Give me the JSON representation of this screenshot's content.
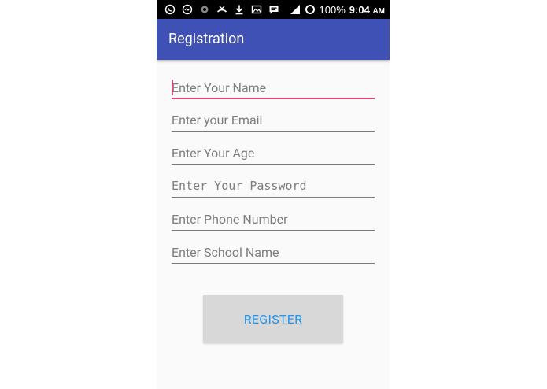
{
  "status_bar": {
    "left_icons": [
      "whatsapp-icon",
      "messenger-icon",
      "record-icon",
      "missed-call-icon",
      "download-icon",
      "gallery-icon",
      "sms-icon"
    ],
    "right_icons": [
      "signal-icon",
      "circle-icon"
    ],
    "battery": "100%",
    "time": "9:04",
    "ampm": "AM"
  },
  "app_bar": {
    "title": "Registration",
    "color": "#3f51b5"
  },
  "form": {
    "name_placeholder": "Enter Your Name",
    "email_placeholder": "Enter your Email",
    "age_placeholder": "Enter Your Age",
    "password_placeholder": "Enter Your Password",
    "phone_placeholder": "Enter Phone Number",
    "school_placeholder": "Enter School Name",
    "accent_color": "#e0457b"
  },
  "register_button": {
    "label": "REGISTER",
    "text_color": "#2196f3"
  }
}
